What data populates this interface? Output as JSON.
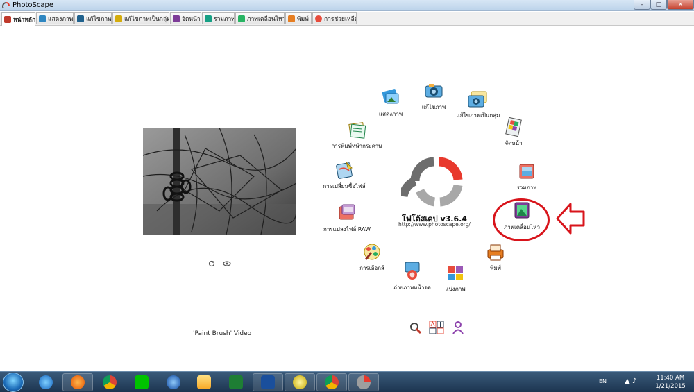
{
  "window": {
    "title": "PhotoScape",
    "controls": {
      "minimize": "–",
      "maximize": "□",
      "close": "✕"
    }
  },
  "tabs": [
    {
      "label": "หน้าหลัก",
      "icon": "home-icon",
      "active": true,
      "color": "#c0392b"
    },
    {
      "label": "แสดงภาพ",
      "icon": "viewer-icon",
      "active": false,
      "color": "#2e86c1"
    },
    {
      "label": "แก้ไขภาพ",
      "icon": "editor-icon",
      "active": false,
      "color": "#1f618d"
    },
    {
      "label": "แก้ไขภาพเป็นกลุ่ม",
      "icon": "batch-editor-icon",
      "active": false,
      "color": "#d4ac0d"
    },
    {
      "label": "จัดหน้า",
      "icon": "page-icon",
      "active": false,
      "color": "#7d3c98"
    },
    {
      "label": "รวมภาพ",
      "icon": "combine-icon",
      "active": false,
      "color": "#16a085"
    },
    {
      "label": "ภาพเคลื่อนไหว",
      "icon": "animated-gif-icon",
      "active": false,
      "color": "#28b463"
    },
    {
      "label": "พิมพ์",
      "icon": "print-icon",
      "active": false,
      "color": "#e67e22"
    },
    {
      "label": "การช่วยเหลือ",
      "icon": "help-icon",
      "active": false,
      "color": "#e74c3c"
    }
  ],
  "logo": {
    "title": "โฟโต้สเคป v3.6.4",
    "url": "http://www.photoscape.org/",
    "accent": "#e8392d",
    "gray": "#6d6d6d"
  },
  "menu": [
    {
      "id": "viewer",
      "label": "แสดงภาพ",
      "icon": "viewer-icon"
    },
    {
      "id": "editor",
      "label": "แก้ไขภาพ",
      "icon": "editor-icon"
    },
    {
      "id": "batch",
      "label": "แก้ไขภาพเป็นกลุ่ม",
      "icon": "batch-editor-icon"
    },
    {
      "id": "page",
      "label": "จัดหน้า",
      "icon": "page-icon"
    },
    {
      "id": "combine",
      "label": "รวมภาพ",
      "icon": "combine-icon"
    },
    {
      "id": "gif",
      "label": "ภาพเคลื่อนไหว",
      "icon": "animated-gif-icon"
    },
    {
      "id": "print",
      "label": "พิมพ์",
      "icon": "print-icon"
    },
    {
      "id": "splitter",
      "label": "แบ่งภาพ",
      "icon": "splitter-icon"
    },
    {
      "id": "capture",
      "label": "ถ่ายภาพหน้าจอ",
      "icon": "screen-capture-icon"
    },
    {
      "id": "picker",
      "label": "การเลือกสี",
      "icon": "color-picker-icon"
    },
    {
      "id": "raw",
      "label": "การแปลงไฟล์ RAW",
      "icon": "raw-converter-icon"
    },
    {
      "id": "rename",
      "label": "การเปลี่ยนชื่อไฟล์",
      "icon": "rename-icon"
    },
    {
      "id": "paperprint",
      "label": "การพิมพ์หน้ากระดาษ",
      "icon": "paper-print-icon"
    }
  ],
  "left_panel": {
    "video_link": "'Paint Brush' Video"
  },
  "bottom_tools": [
    "settings-icon",
    "language-icon",
    "user-icon"
  ],
  "taskbar": {
    "apps": [
      "ie-icon",
      "firefox-icon",
      "chrome-icon",
      "line-icon",
      "google-earth-icon",
      "folder-icon",
      "excel-icon",
      "word-icon",
      "disc-icon",
      "chrome-icon",
      "photoscape-icon"
    ],
    "language": "EN",
    "time": "11:40 AM",
    "date": "1/21/2015"
  }
}
